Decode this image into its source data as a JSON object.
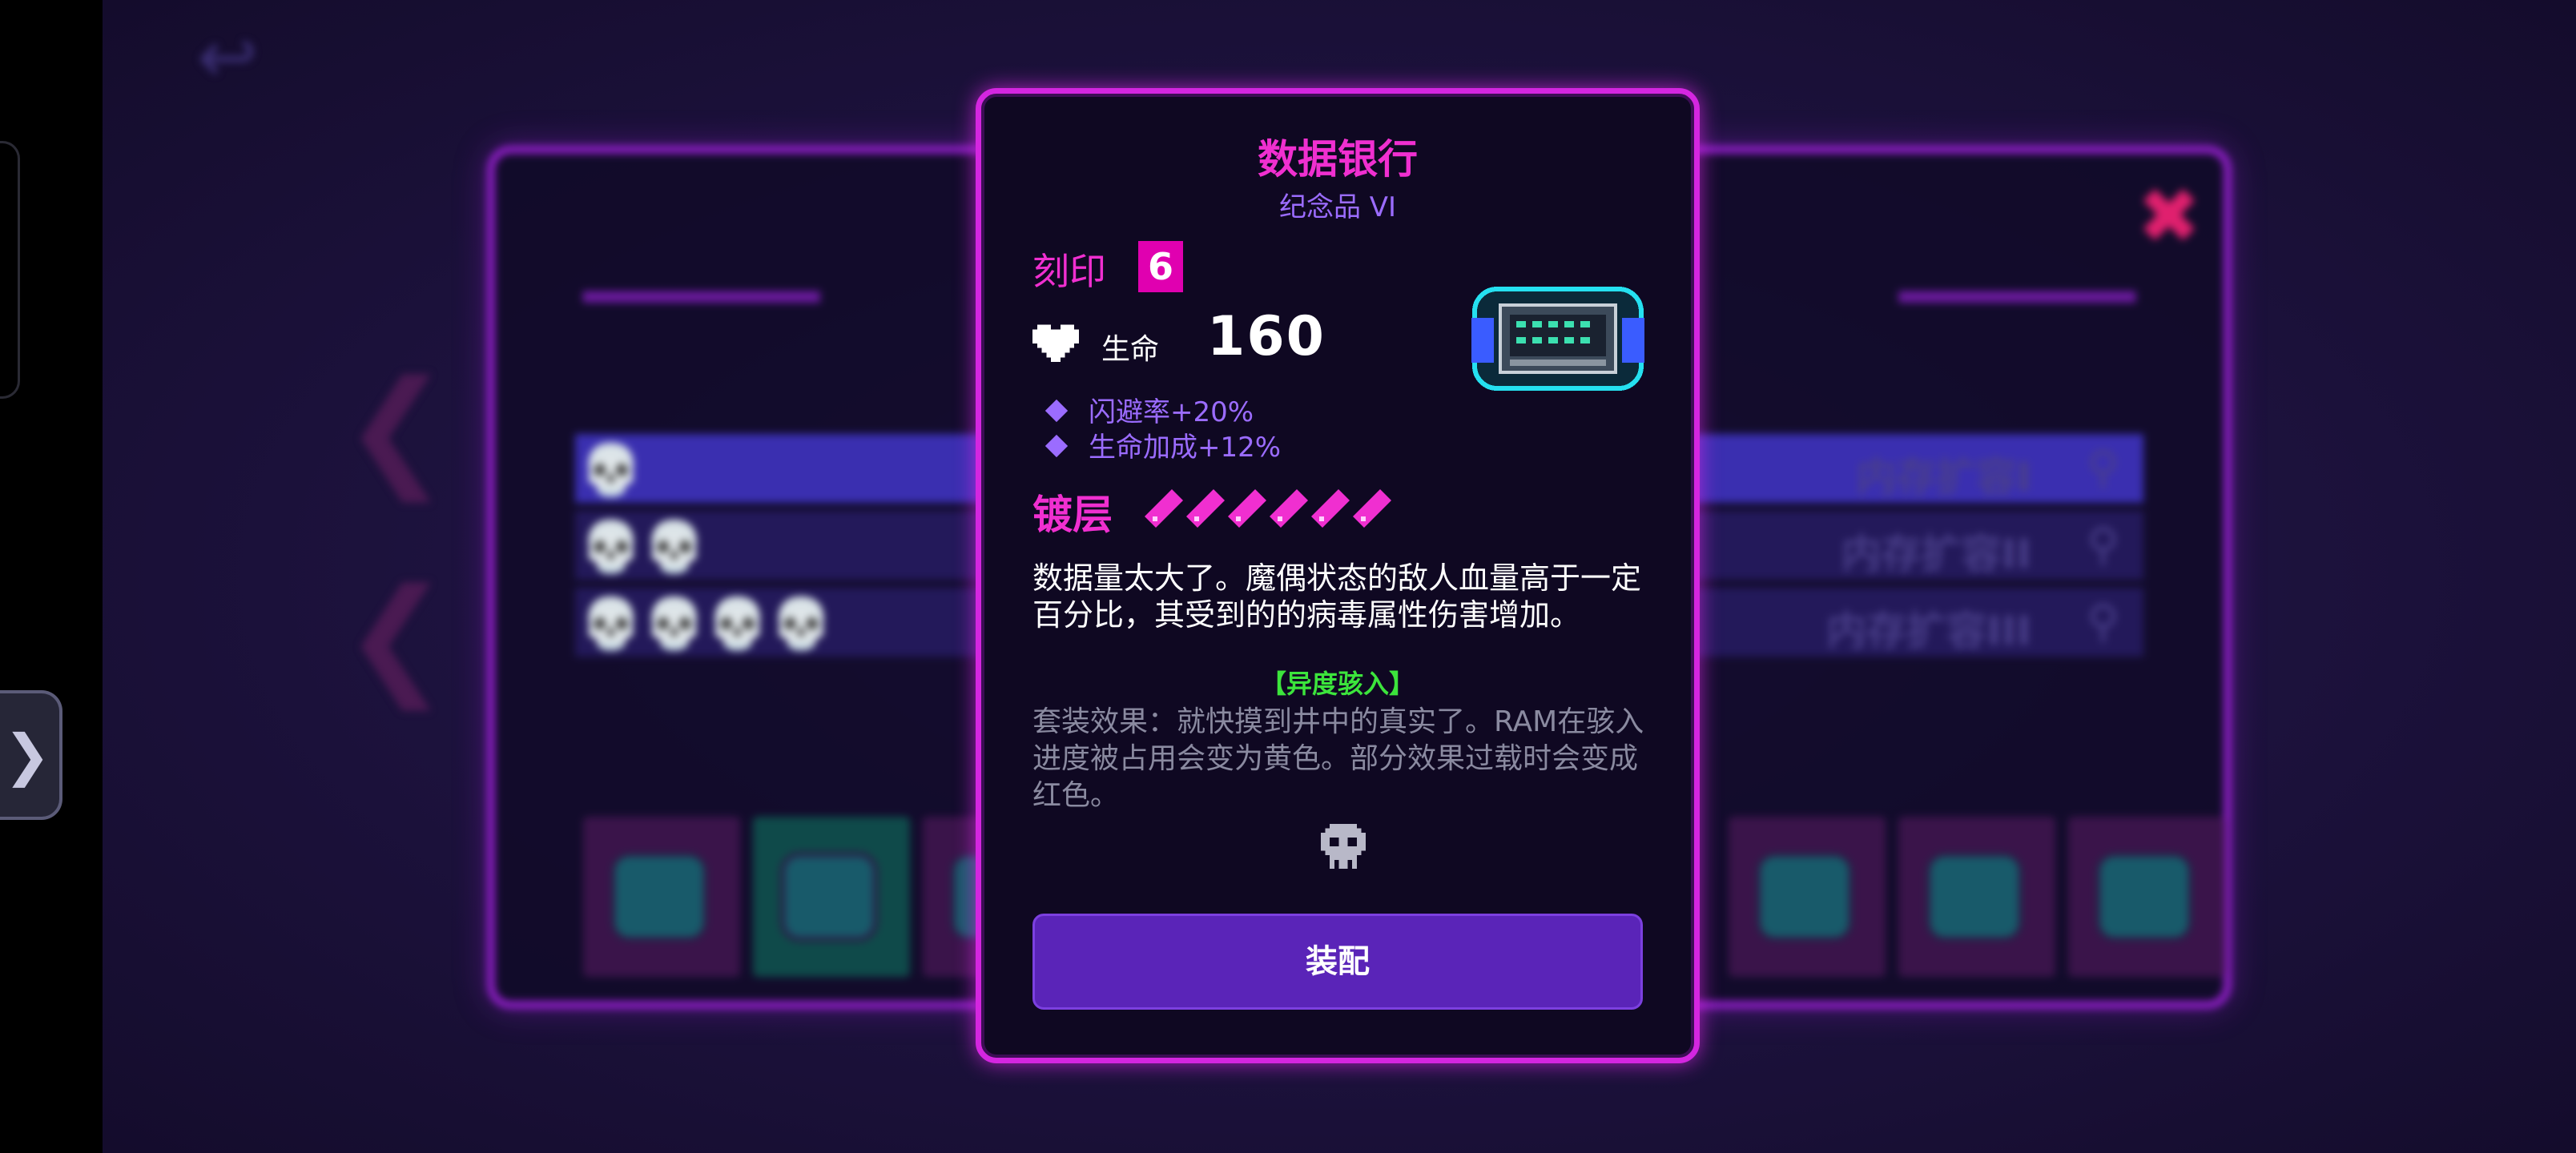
{
  "item": {
    "name": "数据银行",
    "subtitle": "纪念品 VI",
    "engrave_label": "刻印",
    "engrave_level": "6",
    "hp_label": "生命",
    "hp_value": "160",
    "stats": [
      "闪避率+20%",
      "生命加成+12%"
    ],
    "coating_label": "镀层",
    "coating_count": 6,
    "description": "数据量太大了。魔偶状态的敌人血量高于一定百分比，其受到的的病毒属性伤害增加。",
    "set_name": "【异度骇入】",
    "set_description": "套装效果：就快摸到井中的真实了。RAM在骇入进度被占用会变为黄色。部分效果过载时会变成红色。",
    "equip_label": "装配"
  },
  "side_toggle": "❯",
  "background": {
    "back_icon": "↩",
    "close_icon": "✖",
    "rows": [
      {
        "skulls": "💀",
        "label": "内存扩容I"
      },
      {
        "skulls": "💀💀",
        "label": "内存扩容II"
      },
      {
        "skulls": "💀💀💀💀",
        "label": "内存扩容III"
      }
    ]
  },
  "colors": {
    "accent": "#f02fd0",
    "subtitle": "#9b6cff",
    "set": "#3ce43c",
    "button": "#5a24b8"
  },
  "icons": [
    "heart-icon",
    "chip-icon",
    "skull-icon",
    "diamond-bullet-icon",
    "coating-pip-icon",
    "close-icon",
    "back-arrow-icon",
    "magnifier-icon"
  ]
}
